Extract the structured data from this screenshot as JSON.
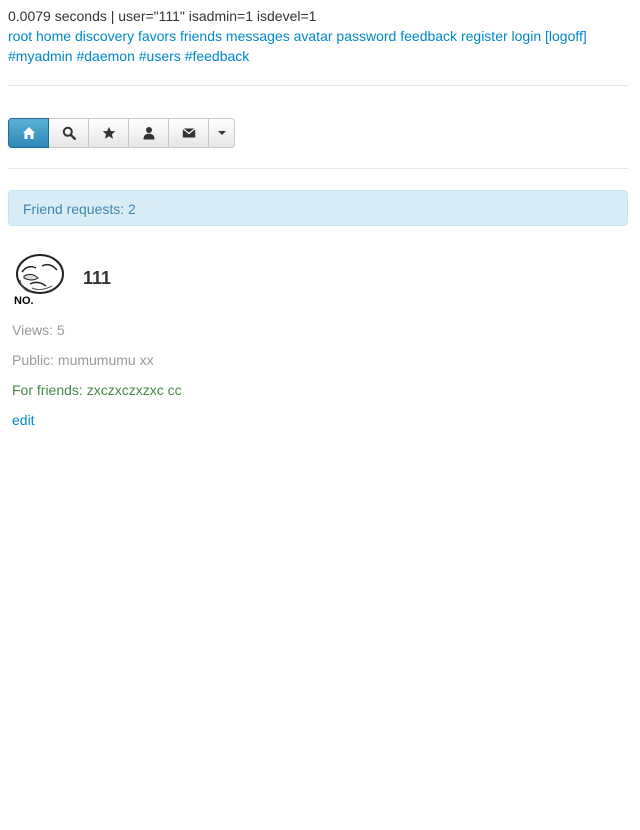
{
  "debug": {
    "text": "0.0079 seconds | user=\"111\" isadmin=1 isdevel=1"
  },
  "nav": {
    "links": [
      "root",
      "home",
      "discovery",
      "favors",
      "friends",
      "messages",
      "avatar",
      "password",
      "feedback",
      "register",
      "login",
      "[logoff]",
      "#myadmin",
      "#daemon",
      "#users",
      "#feedback"
    ]
  },
  "toolbar": {
    "buttons": [
      {
        "icon": "home-icon",
        "active": true
      },
      {
        "icon": "search-icon",
        "active": false
      },
      {
        "icon": "star-icon",
        "active": false
      },
      {
        "icon": "user-icon",
        "active": false
      },
      {
        "icon": "envelope-icon",
        "active": false
      },
      {
        "icon": "caret-down-icon",
        "active": false
      }
    ]
  },
  "alert": {
    "text": "Friend requests: 2"
  },
  "profile": {
    "avatar_text": "NO.",
    "username": "111",
    "views": "Views: 5",
    "public": "Public: mumumumu xx",
    "for_friends": "For friends: zxczxczxzxc cc",
    "edit": "edit"
  },
  "colors": {
    "link": "#0088cc",
    "alert_bg": "#d9edf7",
    "alert_text": "#3a87ad",
    "friends_text": "#468847",
    "muted": "#999999"
  }
}
